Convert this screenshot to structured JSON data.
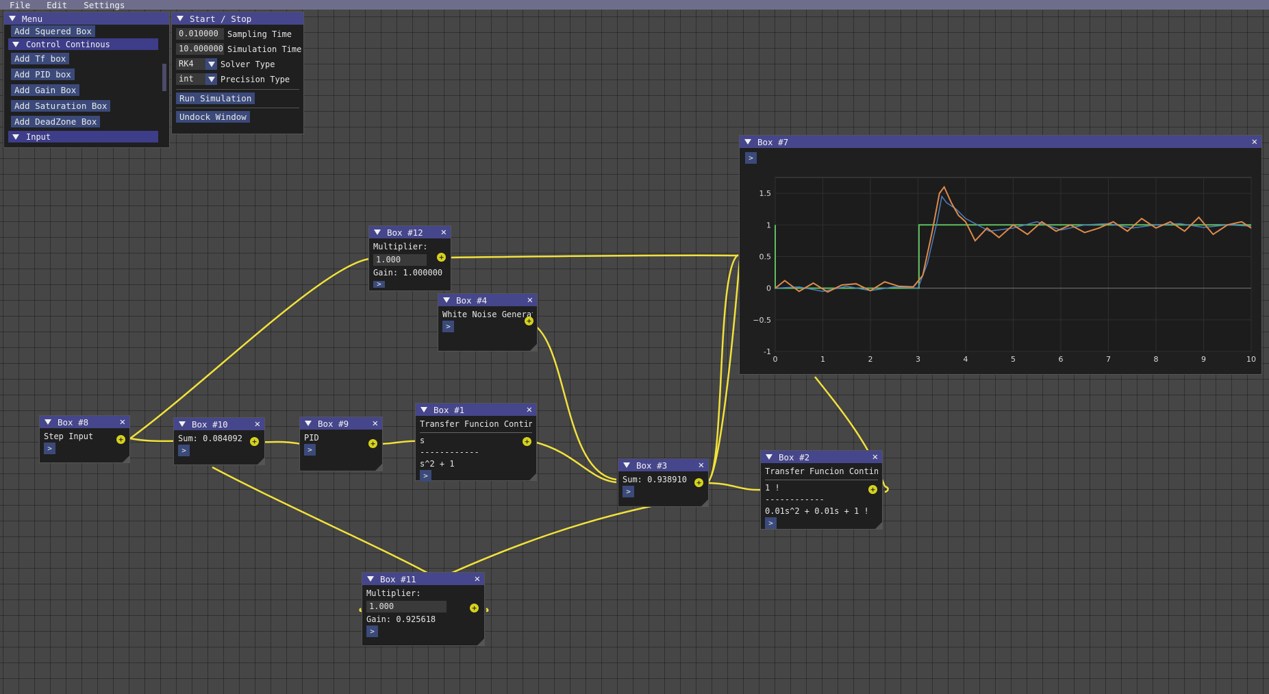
{
  "menubar": {
    "items": [
      "File",
      "Edit",
      "Settings"
    ]
  },
  "menu_panel": {
    "title": "Menu",
    "items": {
      "add_squered": "Add Squered Box",
      "section_control": "Control Continous",
      "add_tf": "Add Tf box",
      "add_pid": "Add PID box",
      "add_gain": "Add Gain Box",
      "add_saturation": "Add Saturation Box",
      "add_deadzone": "Add DeadZone Box",
      "section_input": "Input"
    }
  },
  "start_stop": {
    "title": "Start / Stop",
    "sampling_time_value": "0.010000",
    "sampling_time_label": "Sampling Time",
    "simulation_time_value": "10.000000",
    "simulation_time_label": "Simulation Time",
    "solver_value": "RK4",
    "solver_label": "Solver Type",
    "precision_value": "int",
    "precision_label": "Precision Type",
    "run_button": "Run Simulation",
    "undock_button": "Undock Window"
  },
  "nodes": {
    "box8": {
      "title": "Box #8",
      "text": "Step Input",
      "arrow": ">"
    },
    "box10": {
      "title": "Box #10",
      "text": "Sum: 0.084092",
      "arrow": ">"
    },
    "box9": {
      "title": "Box #9",
      "text": "PID",
      "arrow": ">"
    },
    "box1": {
      "title": "Box #1",
      "name": "Transfer Funcion Contino",
      "num": "s",
      "sep": "------------",
      "den": "s^2 + 1",
      "arrow": ">"
    },
    "box12": {
      "title": "Box #12",
      "label": "Multiplier:",
      "value": "1.000",
      "gain": "Gain: 1.000000",
      "arrow": ">"
    },
    "box4": {
      "title": "Box #4",
      "text": "White Noise Generato",
      "arrow": ">"
    },
    "box3": {
      "title": "Box #3",
      "text": "Sum: 0.938910",
      "arrow": ">"
    },
    "box2": {
      "title": "Box #2",
      "name": "Transfer Funcion Contino",
      "num": "1 !",
      "sep": "------------",
      "den": "0.01s^2 + 0.01s + 1 !",
      "arrow": ">"
    },
    "box11": {
      "title": "Box #11",
      "label": "Multiplier:",
      "value": "1.000",
      "gain": "Gain: 0.925618",
      "arrow": ">"
    }
  },
  "plot_window": {
    "title": "Box #7",
    "arrow": ">"
  },
  "pin_glyph": "+",
  "colors": {
    "wire": "#f2e23a",
    "titlebar": "#46468c",
    "step": "#5fbf5f",
    "noise": "#4c7fc1",
    "response": "#e08a4b"
  },
  "chart_data": {
    "type": "line",
    "xlim": [
      0,
      10
    ],
    "ylim": [
      -1,
      1.75
    ],
    "xticks": [
      0,
      1,
      2,
      3,
      4,
      5,
      6,
      7,
      8,
      9,
      10
    ],
    "yticks": [
      -1,
      -0.5,
      0,
      0.5,
      1,
      1.5
    ],
    "ytick_labels": [
      "-1",
      "−0.5",
      "0",
      "0.5",
      "1",
      "1.5"
    ],
    "grid": true,
    "series": [
      {
        "color": "#5fbf5f",
        "x": [
          0,
          0,
          0.02,
          3.02,
          3.02,
          10
        ],
        "y": [
          1,
          0,
          0,
          0,
          1,
          1
        ]
      },
      {
        "color": "#4c7fc1",
        "x": [
          0,
          0.5,
          1,
          1.5,
          2,
          2.5,
          3,
          3.2,
          3.4,
          3.5,
          3.6,
          3.8,
          4,
          4.5,
          5,
          5.5,
          6,
          6.5,
          7,
          7.5,
          8,
          8.5,
          9,
          9.5,
          10
        ],
        "y": [
          0,
          0.02,
          -0.05,
          0.03,
          -0.04,
          0.02,
          0,
          0.4,
          1.05,
          1.45,
          1.35,
          1.25,
          1.1,
          0.9,
          0.95,
          1.05,
          0.92,
          1.0,
          1.02,
          0.95,
          1.0,
          1.02,
          0.96,
          1.0,
          0.98
        ]
      },
      {
        "color": "#e08a4b",
        "x": [
          0,
          0.2,
          0.5,
          0.8,
          1.1,
          1.4,
          1.7,
          2.0,
          2.3,
          2.6,
          2.9,
          3.1,
          3.3,
          3.45,
          3.55,
          3.7,
          3.85,
          4.0,
          4.2,
          4.45,
          4.7,
          5.0,
          5.3,
          5.6,
          5.9,
          6.2,
          6.5,
          6.8,
          7.1,
          7.4,
          7.7,
          8.0,
          8.3,
          8.6,
          8.9,
          9.2,
          9.5,
          9.8,
          10
        ],
        "y": [
          0,
          0.12,
          -0.05,
          0.08,
          -0.06,
          0.05,
          0.07,
          -0.04,
          0.1,
          0.03,
          0.02,
          0.2,
          0.9,
          1.5,
          1.6,
          1.35,
          1.15,
          1.05,
          0.75,
          0.95,
          0.8,
          1.0,
          0.85,
          1.05,
          0.9,
          1.0,
          0.88,
          0.95,
          1.05,
          0.9,
          1.1,
          0.95,
          1.05,
          0.9,
          1.12,
          0.85,
          1.0,
          1.05,
          0.95
        ]
      }
    ]
  }
}
